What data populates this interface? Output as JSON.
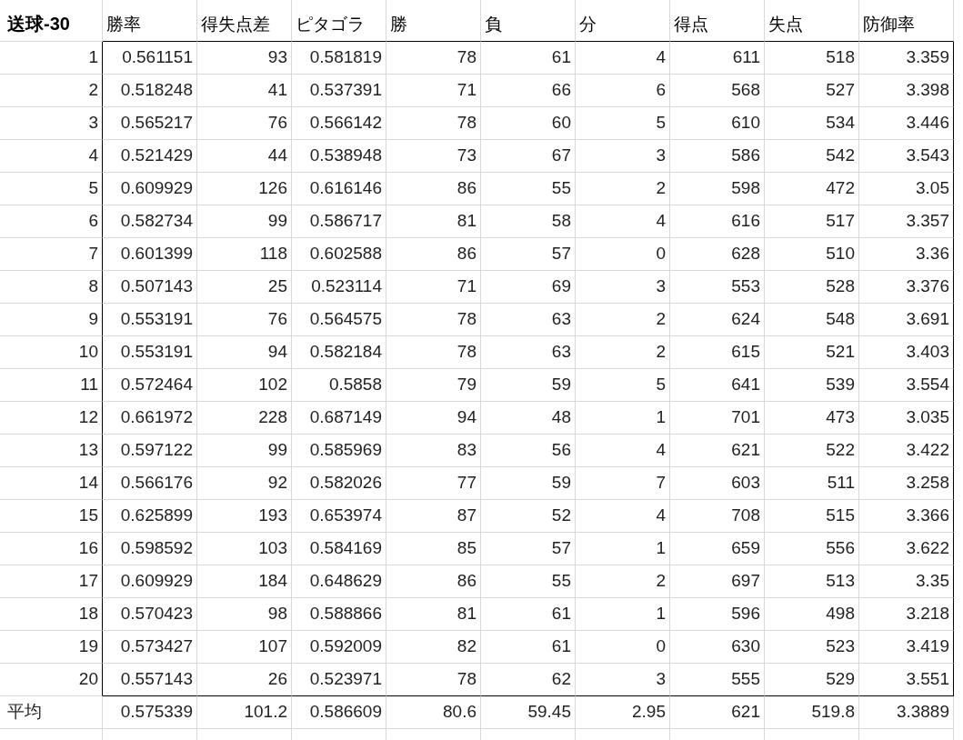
{
  "sheet": {
    "corner": "送球-30",
    "columns": [
      "勝率",
      "得失点差",
      "ピタゴラ",
      "勝",
      "負",
      "分",
      "得点",
      "失点",
      "防御率"
    ],
    "rows": [
      {
        "label": "1",
        "cells": [
          "0.561151",
          "93",
          "0.581819",
          "78",
          "61",
          "4",
          "611",
          "518",
          "3.359"
        ]
      },
      {
        "label": "2",
        "cells": [
          "0.518248",
          "41",
          "0.537391",
          "71",
          "66",
          "6",
          "568",
          "527",
          "3.398"
        ]
      },
      {
        "label": "3",
        "cells": [
          "0.565217",
          "76",
          "0.566142",
          "78",
          "60",
          "5",
          "610",
          "534",
          "3.446"
        ]
      },
      {
        "label": "4",
        "cells": [
          "0.521429",
          "44",
          "0.538948",
          "73",
          "67",
          "3",
          "586",
          "542",
          "3.543"
        ]
      },
      {
        "label": "5",
        "cells": [
          "0.609929",
          "126",
          "0.616146",
          "86",
          "55",
          "2",
          "598",
          "472",
          "3.05"
        ]
      },
      {
        "label": "6",
        "cells": [
          "0.582734",
          "99",
          "0.586717",
          "81",
          "58",
          "4",
          "616",
          "517",
          "3.357"
        ]
      },
      {
        "label": "7",
        "cells": [
          "0.601399",
          "118",
          "0.602588",
          "86",
          "57",
          "0",
          "628",
          "510",
          "3.36"
        ]
      },
      {
        "label": "8",
        "cells": [
          "0.507143",
          "25",
          "0.523114",
          "71",
          "69",
          "3",
          "553",
          "528",
          "3.376"
        ]
      },
      {
        "label": "9",
        "cells": [
          "0.553191",
          "76",
          "0.564575",
          "78",
          "63",
          "2",
          "624",
          "548",
          "3.691"
        ]
      },
      {
        "label": "10",
        "cells": [
          "0.553191",
          "94",
          "0.582184",
          "78",
          "63",
          "2",
          "615",
          "521",
          "3.403"
        ]
      },
      {
        "label": "11",
        "cells": [
          "0.572464",
          "102",
          "0.5858",
          "79",
          "59",
          "5",
          "641",
          "539",
          "3.554"
        ]
      },
      {
        "label": "12",
        "cells": [
          "0.661972",
          "228",
          "0.687149",
          "94",
          "48",
          "1",
          "701",
          "473",
          "3.035"
        ]
      },
      {
        "label": "13",
        "cells": [
          "0.597122",
          "99",
          "0.585969",
          "83",
          "56",
          "4",
          "621",
          "522",
          "3.422"
        ]
      },
      {
        "label": "14",
        "cells": [
          "0.566176",
          "92",
          "0.582026",
          "77",
          "59",
          "7",
          "603",
          "511",
          "3.258"
        ]
      },
      {
        "label": "15",
        "cells": [
          "0.625899",
          "193",
          "0.653974",
          "87",
          "52",
          "4",
          "708",
          "515",
          "3.366"
        ]
      },
      {
        "label": "16",
        "cells": [
          "0.598592",
          "103",
          "0.584169",
          "85",
          "57",
          "1",
          "659",
          "556",
          "3.622"
        ]
      },
      {
        "label": "17",
        "cells": [
          "0.609929",
          "184",
          "0.648629",
          "86",
          "55",
          "2",
          "697",
          "513",
          "3.35"
        ]
      },
      {
        "label": "18",
        "cells": [
          "0.570423",
          "98",
          "0.588866",
          "81",
          "61",
          "1",
          "596",
          "498",
          "3.218"
        ]
      },
      {
        "label": "19",
        "cells": [
          "0.573427",
          "107",
          "0.592009",
          "82",
          "61",
          "0",
          "630",
          "523",
          "3.419"
        ]
      },
      {
        "label": "20",
        "cells": [
          "0.557143",
          "26",
          "0.523971",
          "78",
          "62",
          "3",
          "555",
          "529",
          "3.551"
        ]
      }
    ],
    "footer": {
      "label": "平均",
      "cells": [
        "0.575339",
        "101.2",
        "0.586609",
        "80.6",
        "59.45",
        "2.95",
        "621",
        "519.8",
        "3.3889"
      ]
    }
  }
}
